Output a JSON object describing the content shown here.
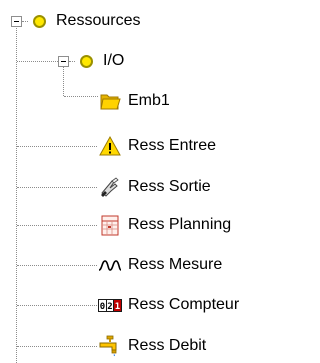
{
  "tree": {
    "root": {
      "label": "Ressources",
      "expanded": true
    },
    "io": {
      "label": "I/O",
      "expanded": true
    },
    "emb1": {
      "label": "Emb1"
    },
    "items": [
      {
        "label": "Ress Entree",
        "icon": "warning-icon"
      },
      {
        "label": "Ress Sortie",
        "icon": "hand-icon"
      },
      {
        "label": "Ress Planning",
        "icon": "planning-icon"
      },
      {
        "label": "Ress Mesure",
        "icon": "wave-icon"
      },
      {
        "label": "Ress Compteur",
        "icon": "counter-icon"
      },
      {
        "label": "Ress Debit",
        "icon": "faucet-icon"
      }
    ],
    "counter_digits": "021"
  },
  "colors": {
    "node_circle": "#ffe800",
    "folder": "#ffd200",
    "warning": "#ffd800"
  }
}
